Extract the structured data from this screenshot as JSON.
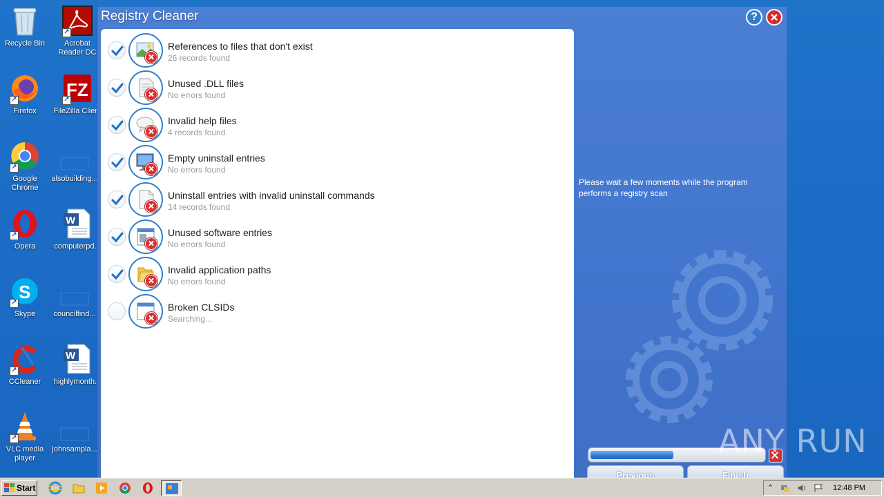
{
  "desktop": {
    "icons": [
      {
        "label": "Recycle Bin"
      },
      {
        "label": "Acrobat Reader DC"
      },
      {
        "label": "Firefox"
      },
      {
        "label": "FileZilla Client"
      },
      {
        "label": "Google Chrome"
      },
      {
        "label": "alsobuilding..."
      },
      {
        "label": "Opera"
      },
      {
        "label": "computerpd..."
      },
      {
        "label": "Skype"
      },
      {
        "label": "councilfind..."
      },
      {
        "label": "CCleaner"
      },
      {
        "label": "highlymonth..."
      },
      {
        "label": "VLC media player"
      },
      {
        "label": "johnsampla..."
      }
    ]
  },
  "window": {
    "title": "Registry Cleaner",
    "help_label": "?",
    "items": [
      {
        "name": "References to files that don't exist",
        "status": "26 records found",
        "checked": true,
        "icon": "image-file-icon"
      },
      {
        "name": "Unused .DLL files",
        "status": "No errors found",
        "checked": true,
        "icon": "dll-file-icon"
      },
      {
        "name": "Invalid help files",
        "status": "4 records found",
        "checked": true,
        "icon": "help-bubble-icon"
      },
      {
        "name": "Empty uninstall entries",
        "status": "No errors found",
        "checked": true,
        "icon": "monitor-icon"
      },
      {
        "name": "Uninstall entries with invalid uninstall commands",
        "status": "14 records found",
        "checked": true,
        "icon": "document-icon"
      },
      {
        "name": "Unused software entries",
        "status": "No errors found",
        "checked": true,
        "icon": "window-icon"
      },
      {
        "name": "Invalid application paths",
        "status": "No errors found",
        "checked": true,
        "icon": "folder-icon"
      },
      {
        "name": "Broken CLSIDs",
        "status": "Searching...",
        "checked": false,
        "icon": "window-icon"
      }
    ],
    "side_message": "Please wait a few moments while the program performs a registry scan",
    "progress_percent": 48,
    "previous_label": "Previous",
    "finish_label": "Finish"
  },
  "watermark": "ANY RUN",
  "taskbar": {
    "start_label": "Start",
    "clock": "12:48 PM"
  },
  "colors": {
    "accent": "#2d7fd0",
    "error_red": "#d73030",
    "window_blue": "#4275cd"
  }
}
